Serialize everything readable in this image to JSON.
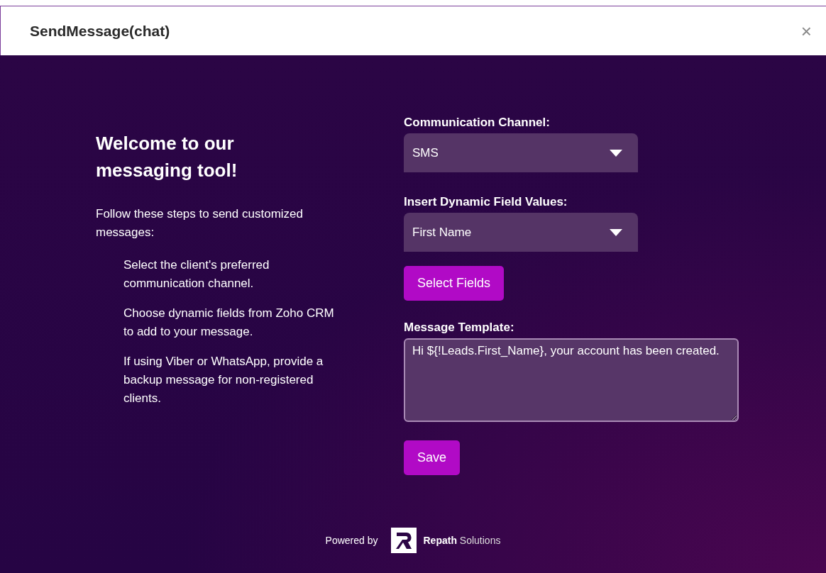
{
  "window": {
    "title": "SendMessage(chat)",
    "close": "×"
  },
  "intro": {
    "heading": "Welcome to our messaging tool!",
    "lead": "Follow these steps to send customized messages:",
    "steps": [
      "Select the client's preferred communication channel.",
      "Choose dynamic fields from Zoho CRM to add to your message.",
      "If using Viber or WhatsApp, provide a backup message for non-registered clients."
    ]
  },
  "form": {
    "channel": {
      "label": "Communication Channel:",
      "value": "SMS"
    },
    "dynamic_field": {
      "label": "Insert Dynamic Field Values:",
      "value": "First Name"
    },
    "select_button": "Select Fields",
    "template": {
      "label": "Message Template:",
      "value": "Hi ${!Leads.First_Name}, your account has been created."
    },
    "save_button": "Save"
  },
  "footer": {
    "powered_by": "Powered by",
    "brand_bold": "Repath",
    "brand_rest": "Solutions"
  }
}
